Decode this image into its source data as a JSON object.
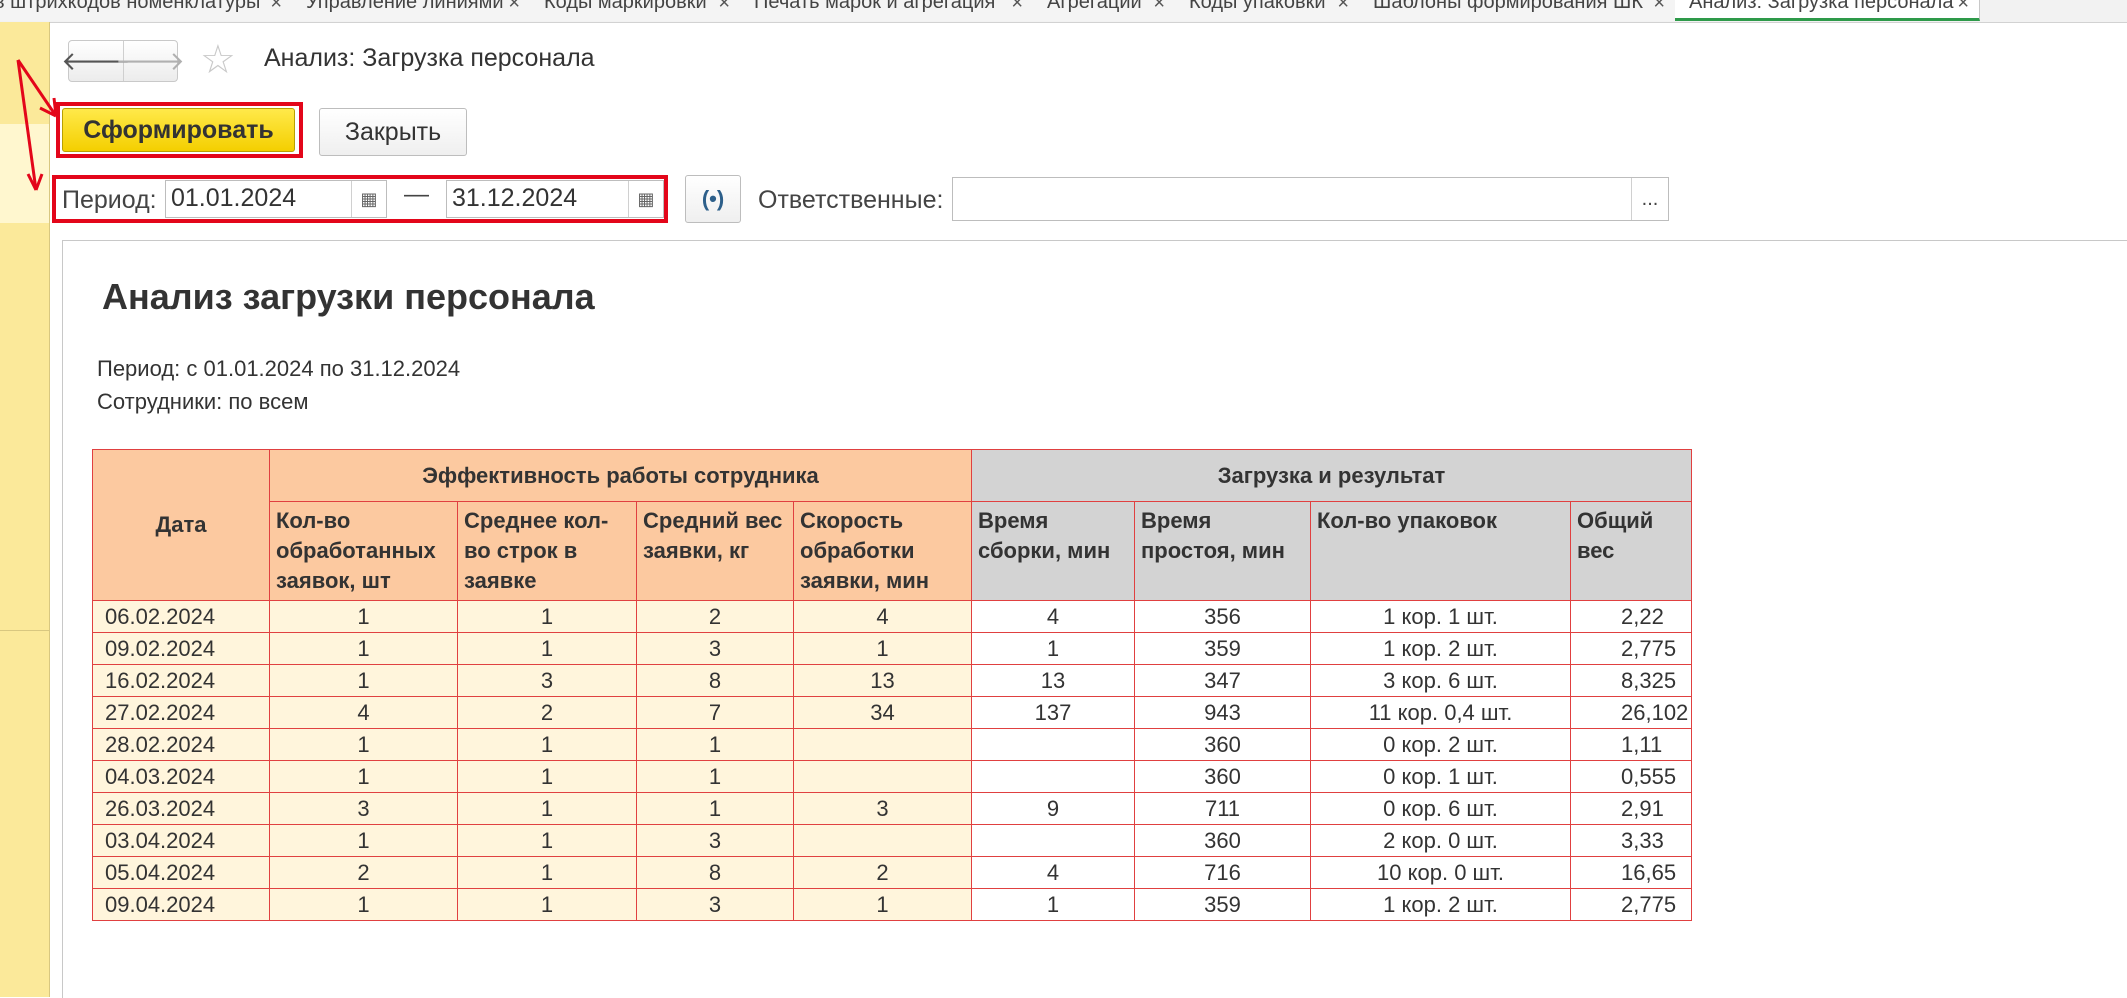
{
  "tabs": [
    {
      "label": "в штрихкодов номенклатуры",
      "close": "×",
      "active": false
    },
    {
      "label": "Управление линиями",
      "close": "×",
      "active": false
    },
    {
      "label": "Коды маркировки",
      "close": "×",
      "active": false
    },
    {
      "label": "Печать марок и агрегация",
      "close": "×",
      "active": false
    },
    {
      "label": "Агрегации",
      "close": "×",
      "active": false
    },
    {
      "label": "Коды упаковки",
      "close": "×",
      "active": false
    },
    {
      "label": "Шаблоны формирования ШК",
      "close": "×",
      "active": false
    },
    {
      "label": "Анализ: Загрузка персонала",
      "close": "×",
      "active": true
    }
  ],
  "header": {
    "back_icon": "🡐",
    "forward_icon": "🡒",
    "favorite_icon": "☆",
    "title": "Анализ: Загрузка персонала"
  },
  "toolbar": {
    "generate_label": "Сформировать",
    "close_label": "Закрыть"
  },
  "filters": {
    "period_label": "Период:",
    "date_from": "01.01.2024",
    "dash": "—",
    "date_to": "31.12.2024",
    "calendar_icon": "▦",
    "link_icon": "(•)",
    "responsible_label": "Ответственные:",
    "responsible_value": "",
    "select_icon": "..."
  },
  "report": {
    "title": "Анализ загрузки персонала",
    "period_line": "Период: с 01.01.2024 по 31.12.2024",
    "staff_line": "Сотрудники: по всем",
    "table": {
      "date_header": "Дата",
      "group1_header": "Эффективность работы сотрудника",
      "group2_header": "Загрузка и результат",
      "columns": [
        "Кол-во обработанных заявок, шт",
        "Среднее кол-во строк в заявке",
        "Средний вес заявки, кг",
        "Скорость обработки заявки, мин",
        "Время сборки, мин",
        "Время простоя, мин",
        "Кол-во упаковок",
        "Общий вес"
      ],
      "rows": [
        [
          "06.02.2024",
          "1",
          "1",
          "2",
          "4",
          "4",
          "356",
          "1 кор. 1 шт.",
          "2,22"
        ],
        [
          "09.02.2024",
          "1",
          "1",
          "3",
          "1",
          "1",
          "359",
          "1 кор. 2 шт.",
          "2,775"
        ],
        [
          "16.02.2024",
          "1",
          "3",
          "8",
          "13",
          "13",
          "347",
          "3 кор. 6 шт.",
          "8,325"
        ],
        [
          "27.02.2024",
          "4",
          "2",
          "7",
          "34",
          "137",
          "943",
          "11 кор. 0,4 шт.",
          "26,102"
        ],
        [
          "28.02.2024",
          "1",
          "1",
          "1",
          "",
          "",
          "360",
          "0 кор. 2 шт.",
          "1,11"
        ],
        [
          "04.03.2024",
          "1",
          "1",
          "1",
          "",
          "",
          "360",
          "0 кор. 1 шт.",
          "0,555"
        ],
        [
          "26.03.2024",
          "3",
          "1",
          "1",
          "3",
          "9",
          "711",
          "0 кор. 6 шт.",
          "2,91"
        ],
        [
          "03.04.2024",
          "1",
          "1",
          "3",
          "",
          "",
          "360",
          "2 кор. 0 шт.",
          "3,33"
        ],
        [
          "05.04.2024",
          "2",
          "1",
          "8",
          "2",
          "4",
          "716",
          "10 кор. 0 шт.",
          "16,65"
        ],
        [
          "09.04.2024",
          "1",
          "1",
          "3",
          "1",
          "1",
          "359",
          "1 кор. 2 шт.",
          "2,775"
        ]
      ]
    }
  },
  "colors": {
    "highlight_red": "#e3061a",
    "generate_button_yellow": "#f4cf00",
    "left_panel": "#fbe99a",
    "header_orange": "#fcc9a0",
    "header_gray": "#d3d3d3",
    "row_cream": "#fff5dc",
    "grid_red": "#e04040"
  }
}
